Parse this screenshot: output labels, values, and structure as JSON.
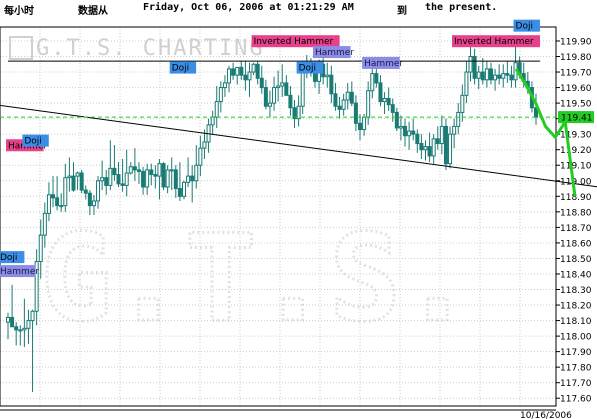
{
  "header": {
    "period": "每小时",
    "source": "数据从",
    "datetime": "Friday, Oct 06, 2006 at 01:21:29 AM",
    "to": "到",
    "present": "the present."
  },
  "watermark": {
    "logo_text": "G.T.S. CHARTING",
    "big_text": "G.T.S."
  },
  "colors": {
    "up": "#1a7a74",
    "down": "#1a7a74",
    "price_box": "#22cc22",
    "forecast": "#22cc22",
    "grid": "#cccccc",
    "pink": "#e8418c",
    "blue": "#3a8ee6",
    "purple": "#8c8ce6"
  },
  "chart_data": {
    "type": "candlestick",
    "ylim": [
      117.55,
      119.99
    ],
    "y_ticks": [
      "119.90",
      "119.80",
      "119.70",
      "119.60",
      "119.50",
      "119.40",
      "119.30",
      "119.20",
      "119.10",
      "119.00",
      "118.90",
      "118.80",
      "118.70",
      "118.60",
      "118.50",
      "118.40",
      "118.30",
      "118.20",
      "118.10",
      "118.00",
      "117.90",
      "117.80",
      "117.70",
      "117.60"
    ],
    "x_label": "10/16/2006",
    "current_price": "119.41",
    "candles": [
      [
        118.09,
        118.15,
        117.98,
        118.12
      ],
      [
        118.12,
        118.33,
        118.06,
        118.06
      ],
      [
        118.06,
        118.09,
        117.94,
        118.04
      ],
      [
        118.04,
        118.07,
        117.94,
        118.04
      ],
      [
        118.04,
        118.24,
        117.93,
        118.05
      ],
      [
        118.05,
        118.17,
        117.95,
        118.1
      ],
      [
        118.1,
        118.17,
        117.64,
        118.16
      ],
      [
        118.16,
        118.56,
        118.07,
        118.48
      ],
      [
        118.48,
        118.75,
        118.37,
        118.65
      ],
      [
        118.65,
        118.86,
        118.57,
        118.79
      ],
      [
        118.79,
        118.99,
        118.74,
        118.91
      ],
      [
        118.91,
        119.03,
        118.83,
        118.89
      ],
      [
        118.89,
        119.03,
        118.81,
        118.84
      ],
      [
        118.84,
        118.92,
        118.8,
        118.84
      ],
      [
        118.84,
        119.11,
        118.8,
        119.02
      ],
      [
        119.02,
        119.15,
        118.93,
        119.03
      ],
      [
        119.03,
        119.12,
        118.93,
        118.94
      ],
      [
        119.03,
        119.06,
        118.94,
        119.05
      ],
      [
        119.05,
        119.07,
        118.92,
        118.94
      ],
      [
        118.94,
        118.97,
        118.88,
        118.92
      ],
      [
        118.92,
        118.94,
        118.78,
        118.84
      ],
      [
        118.84,
        118.91,
        118.78,
        118.87
      ],
      [
        118.87,
        119.03,
        118.82,
        119.0
      ],
      [
        119.0,
        119.13,
        118.94,
        119.02
      ],
      [
        119.02,
        119.07,
        118.91,
        118.97
      ],
      [
        118.97,
        119.26,
        118.94,
        119.08
      ],
      [
        119.08,
        119.23,
        119.0,
        119.04
      ],
      [
        119.04,
        119.12,
        118.96,
        118.98
      ],
      [
        118.98,
        119.14,
        118.93,
        118.97
      ],
      [
        118.97,
        119.2,
        118.9,
        119.05
      ],
      [
        119.05,
        119.12,
        119.04,
        119.09
      ],
      [
        119.09,
        119.21,
        119.0,
        119.07
      ],
      [
        119.07,
        119.12,
        118.98,
        119.06
      ],
      [
        119.06,
        119.09,
        118.91,
        118.96
      ],
      [
        118.96,
        119.11,
        118.91,
        119.07
      ],
      [
        119.07,
        119.11,
        118.97,
        119.04
      ],
      [
        119.04,
        119.1,
        118.95,
        119.03
      ],
      [
        119.03,
        119.14,
        118.88,
        119.11
      ],
      [
        119.11,
        119.12,
        118.94,
        118.96
      ],
      [
        118.96,
        119.1,
        118.92,
        119.07
      ],
      [
        119.07,
        119.15,
        118.94,
        119.07
      ],
      [
        119.07,
        119.1,
        118.89,
        118.95
      ],
      [
        118.95,
        119.12,
        118.87,
        118.9
      ],
      [
        118.9,
        119.0,
        118.88,
        118.99
      ],
      [
        118.99,
        119.15,
        118.96,
        119.03
      ],
      [
        119.03,
        119.1,
        118.86,
        119.0
      ],
      [
        119.0,
        119.23,
        118.95,
        119.1
      ],
      [
        119.1,
        119.29,
        119.03,
        119.21
      ],
      [
        119.21,
        119.33,
        119.14,
        119.25
      ],
      [
        119.25,
        119.4,
        119.18,
        119.36
      ],
      [
        119.36,
        119.45,
        119.3,
        119.41
      ],
      [
        119.41,
        119.61,
        119.34,
        119.51
      ],
      [
        119.51,
        119.64,
        119.44,
        119.6
      ],
      [
        119.6,
        119.68,
        119.54,
        119.63
      ],
      [
        119.63,
        119.74,
        119.57,
        119.72
      ],
      [
        119.72,
        119.76,
        119.65,
        119.68
      ],
      [
        119.68,
        119.73,
        119.62,
        119.73
      ],
      [
        119.73,
        119.77,
        119.65,
        119.68
      ],
      [
        119.68,
        119.77,
        119.58,
        119.65
      ],
      [
        119.65,
        119.76,
        119.54,
        119.7
      ],
      [
        119.7,
        119.76,
        119.68,
        119.75
      ],
      [
        119.75,
        119.77,
        119.62,
        119.66
      ],
      [
        119.66,
        119.74,
        119.56,
        119.6
      ],
      [
        119.6,
        119.65,
        119.46,
        119.48
      ],
      [
        119.48,
        119.58,
        119.41,
        119.5
      ],
      [
        119.5,
        119.67,
        119.45,
        119.6
      ],
      [
        119.6,
        119.71,
        119.51,
        119.61
      ],
      [
        119.61,
        119.75,
        119.54,
        119.63
      ],
      [
        119.63,
        119.68,
        119.55,
        119.55
      ],
      [
        119.55,
        119.61,
        119.42,
        119.47
      ],
      [
        119.47,
        119.52,
        119.34,
        119.4
      ],
      [
        119.4,
        119.55,
        119.35,
        119.48
      ],
      [
        119.48,
        119.73,
        119.43,
        119.7
      ],
      [
        119.7,
        119.81,
        119.66,
        119.76
      ],
      [
        119.76,
        119.79,
        119.67,
        119.72
      ],
      [
        119.72,
        119.76,
        119.6,
        119.64
      ],
      [
        119.64,
        119.78,
        119.56,
        119.75
      ],
      [
        119.75,
        119.79,
        119.62,
        119.67
      ],
      [
        119.67,
        119.76,
        119.6,
        119.68
      ],
      [
        119.68,
        119.74,
        119.5,
        119.56
      ],
      [
        119.56,
        119.63,
        119.45,
        119.48
      ],
      [
        119.48,
        119.54,
        119.4,
        119.46
      ],
      [
        119.46,
        119.56,
        119.42,
        119.52
      ],
      [
        119.52,
        119.63,
        119.46,
        119.57
      ],
      [
        119.57,
        119.64,
        119.48,
        119.5
      ],
      [
        119.5,
        119.55,
        119.32,
        119.37
      ],
      [
        119.37,
        119.43,
        119.26,
        119.33
      ],
      [
        119.33,
        119.43,
        119.29,
        119.41
      ],
      [
        119.41,
        119.64,
        119.36,
        119.58
      ],
      [
        119.58,
        119.72,
        119.53,
        119.69
      ],
      [
        119.69,
        119.73,
        119.6,
        119.63
      ],
      [
        119.63,
        119.68,
        119.48,
        119.51
      ],
      [
        119.51,
        119.57,
        119.43,
        119.53
      ],
      [
        119.53,
        119.6,
        119.45,
        119.49
      ],
      [
        119.49,
        119.53,
        119.38,
        119.44
      ],
      [
        119.44,
        119.47,
        119.32,
        119.34
      ],
      [
        119.34,
        119.42,
        119.26,
        119.35
      ],
      [
        119.35,
        119.4,
        119.22,
        119.29
      ],
      [
        119.29,
        119.38,
        119.2,
        119.32
      ],
      [
        119.32,
        119.4,
        119.26,
        119.3
      ],
      [
        119.3,
        119.33,
        119.18,
        119.24
      ],
      [
        119.24,
        119.3,
        119.14,
        119.2
      ],
      [
        119.2,
        119.26,
        119.13,
        119.22
      ],
      [
        119.22,
        119.31,
        119.12,
        119.16
      ],
      [
        119.16,
        119.3,
        119.11,
        119.27
      ],
      [
        119.27,
        119.35,
        119.2,
        119.24
      ],
      [
        119.24,
        119.42,
        119.17,
        119.35
      ],
      [
        119.35,
        119.4,
        119.07,
        119.11
      ],
      [
        119.11,
        119.35,
        119.08,
        119.3
      ],
      [
        119.3,
        119.4,
        119.21,
        119.35
      ],
      [
        119.35,
        119.5,
        119.3,
        119.44
      ],
      [
        119.44,
        119.62,
        119.38,
        119.55
      ],
      [
        119.55,
        119.77,
        119.5,
        119.7
      ],
      [
        119.7,
        119.88,
        119.64,
        119.8
      ],
      [
        119.8,
        119.85,
        119.62,
        119.66
      ],
      [
        119.66,
        119.74,
        119.59,
        119.7
      ],
      [
        119.7,
        119.79,
        119.62,
        119.65
      ],
      [
        119.65,
        119.77,
        119.6,
        119.72
      ],
      [
        119.72,
        119.76,
        119.62,
        119.65
      ],
      [
        119.65,
        119.72,
        119.58,
        119.68
      ],
      [
        119.68,
        119.75,
        119.62,
        119.66
      ],
      [
        119.66,
        119.75,
        119.6,
        119.69
      ],
      [
        119.69,
        119.77,
        119.63,
        119.68
      ],
      [
        119.68,
        119.74,
        119.6,
        119.65
      ],
      [
        119.65,
        119.88,
        119.6,
        119.76
      ],
      [
        119.76,
        119.8,
        119.66,
        119.69
      ],
      [
        119.69,
        119.76,
        119.6,
        119.64
      ],
      [
        119.64,
        119.7,
        119.56,
        119.6
      ],
      [
        119.6,
        119.64,
        119.44,
        119.47
      ],
      [
        119.47,
        119.56,
        119.36,
        119.41
      ]
    ],
    "trendlines": [
      {
        "from": [
          0,
          119.77
        ],
        "to": [
          130,
          119.77
        ]
      },
      {
        "from": [
          -20,
          119.55
        ],
        "to": [
          150,
          118.94
        ]
      }
    ],
    "forecast_path": [
      119.72,
      119.62,
      119.5,
      119.35,
      119.28,
      119.38,
      118.9
    ],
    "patterns": [
      {
        "label": "Hammer",
        "bar": 0,
        "price": 119.19,
        "color": "pink"
      },
      {
        "label": "Doji",
        "bar": 4,
        "price": 119.22,
        "color": "blue"
      },
      {
        "label": "Doji",
        "bar": -3,
        "price": 118.47,
        "color": "blue"
      },
      {
        "label": "Hammer",
        "bar": -3,
        "price": 118.38,
        "color": "purple"
      },
      {
        "label": "Doji",
        "bar": 40,
        "price": 119.69,
        "color": "blue"
      },
      {
        "label": "Inverted Hammer",
        "bar": 60,
        "price": 119.86,
        "color": "pink"
      },
      {
        "label": "Doji",
        "bar": 71,
        "price": 119.69,
        "color": "blue"
      },
      {
        "label": "Hammer",
        "bar": 75,
        "price": 119.79,
        "color": "purple"
      },
      {
        "label": "Hammer",
        "bar": 87,
        "price": 119.72,
        "color": "purple"
      },
      {
        "label": "Inverted Hammer",
        "bar": 113,
        "price": 119.86,
        "color": "pink"
      },
      {
        "label": "Doji",
        "bar": 124,
        "price": 119.96,
        "color": "blue"
      }
    ]
  }
}
